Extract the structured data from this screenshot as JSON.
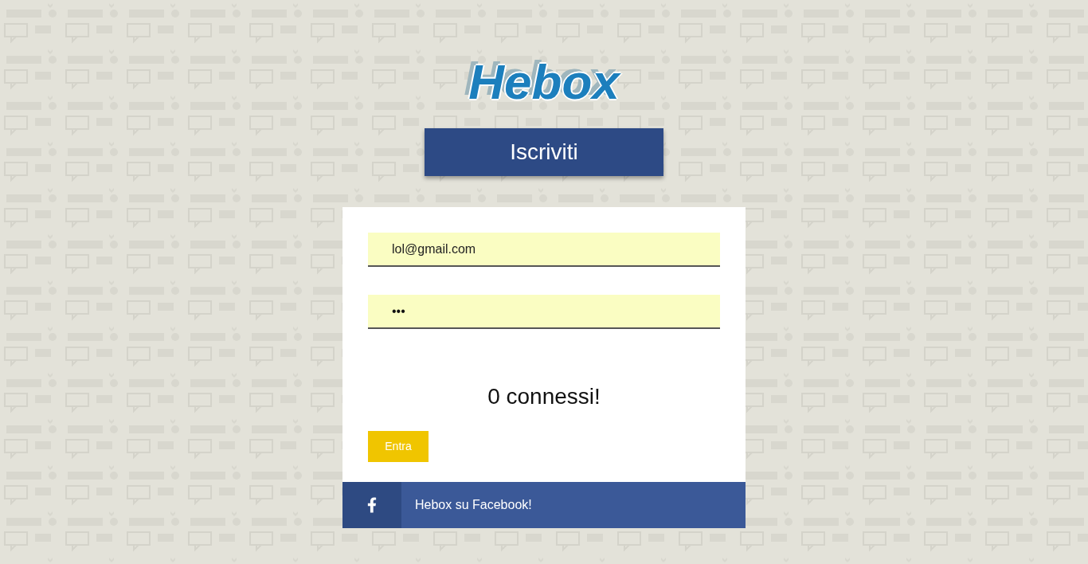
{
  "logo": "Hebox",
  "signup_button": "Iscriviti",
  "form": {
    "email": {
      "value": "lol@gmail.com"
    },
    "password": {
      "value": "•••"
    },
    "online_count": "0 connessi!",
    "submit": "Entra"
  },
  "facebook_link": "Hebox su Facebook!"
}
